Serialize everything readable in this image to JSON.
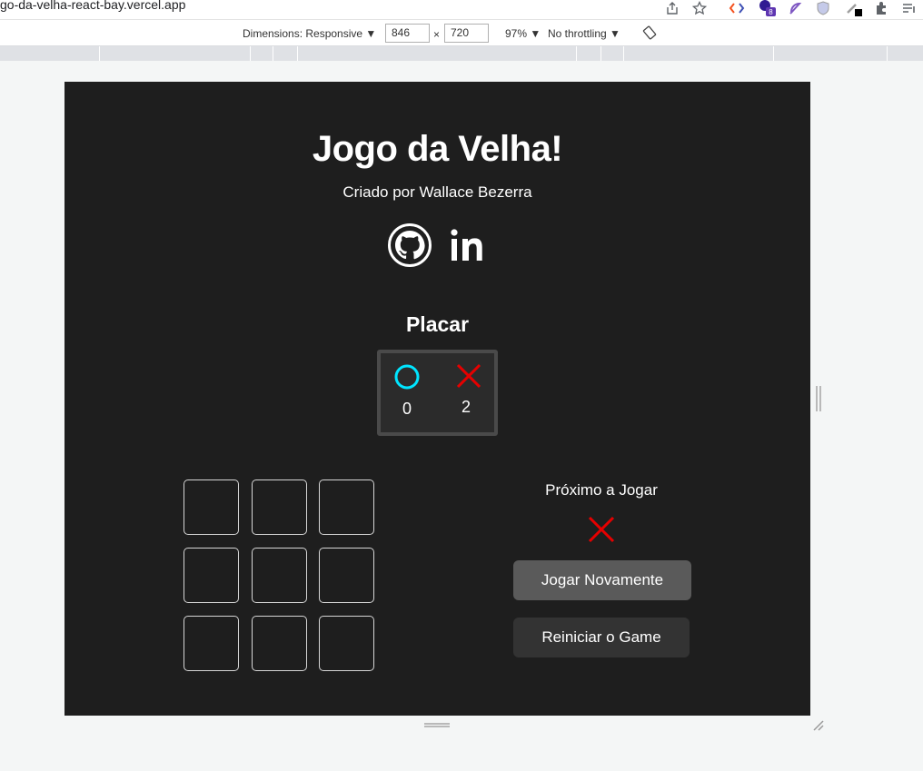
{
  "browser": {
    "url": "go-da-velha-react-bay.vercel.app",
    "extension_badge": "8"
  },
  "devtools": {
    "dimensions_label": "Dimensions: Responsive ▼",
    "width": "846",
    "times": "×",
    "height": "720",
    "zoom": "97% ▼",
    "throttling": "No throttling ▼"
  },
  "app": {
    "title": "Jogo da Velha!",
    "subtitle": "Criado por Wallace Bezerra",
    "social": [
      "github-icon",
      "linkedin-icon"
    ],
    "scoreboard": {
      "title": "Placar",
      "o_score": "0",
      "x_score": "2",
      "o_color": "#00e5ff",
      "x_color": "#e60000"
    },
    "board": [
      "",
      "",
      "",
      "",
      "",
      "",
      "",
      "",
      ""
    ],
    "next_player_label": "Próximo a Jogar",
    "next_player": "X",
    "play_again_label": "Jogar Novamente",
    "restart_label": "Reiniciar o Game"
  }
}
